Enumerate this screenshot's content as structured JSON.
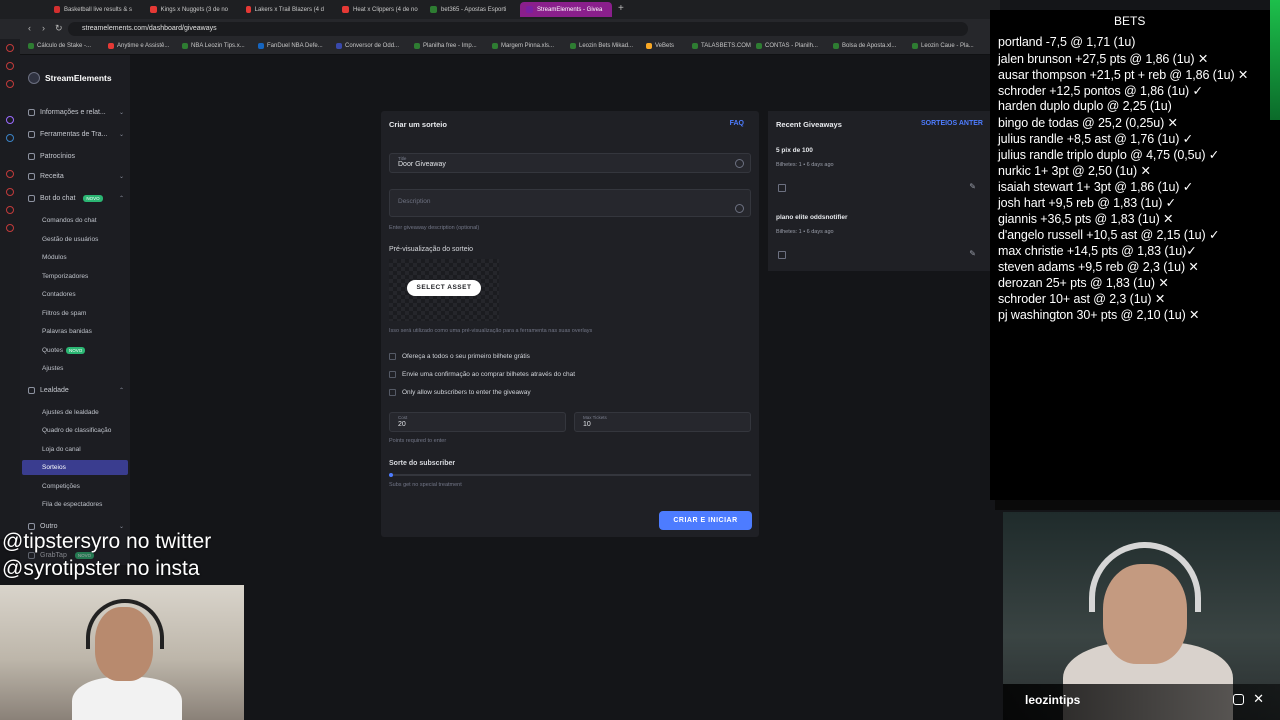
{
  "browser": {
    "tabs": [
      {
        "label": "Basketball live results & s",
        "color": "#d32f2f",
        "active": false
      },
      {
        "label": "Kings x Nuggets (3 de no",
        "color": "#e53935",
        "active": false
      },
      {
        "label": "Lakers x Trail Blazers (4 d",
        "color": "#e53935",
        "active": false
      },
      {
        "label": "Heat x Clippers (4 de no",
        "color": "#e53935",
        "active": false
      },
      {
        "label": "bet365 - Apostas Esporti",
        "color": "#2e7d32",
        "active": false
      },
      {
        "label": "StreamElements - Givea",
        "color": "#7b1fa2",
        "active": true
      }
    ],
    "url": "streamelements.com/dashboard/giveaways",
    "bookmarks": [
      "Cálculo de Stake -...",
      "Anytime e Assistê...",
      "NBA Leozin Tips.x...",
      "FanDuel NBA Defe...",
      "Conversor de Odd...",
      "Planilha free - Imp...",
      "Margem Pinna.xls...",
      "Leozin Bets Mikad...",
      "VeBets",
      "TALASBETS.COM",
      "CONTAS - Planilh...",
      "Bolsa de Aposta.xl...",
      "Leozin Caue - Pla..."
    ]
  },
  "sidebar": {
    "brand": "StreamElements",
    "items": [
      {
        "label": "Informações e relat...",
        "chevron": "⌄"
      },
      {
        "label": "Ferramentas de Tra...",
        "chevron": "⌄"
      },
      {
        "label": "Patrocínios",
        "chevron": ""
      },
      {
        "label": "Receita",
        "chevron": "⌄"
      },
      {
        "label": "Bot do chat",
        "chevron": "⌃",
        "badge": "NOVO"
      }
    ],
    "bot_sub": [
      "Comandos do chat",
      "Gestão de usuários",
      "Módulos",
      "Temporizadores",
      "Contadores",
      "Filtros de spam",
      "Palavras banidas",
      "Quotes",
      "Ajustes"
    ],
    "quotes_badge": "NOVO",
    "loyalty": {
      "label": "Lealdade",
      "chevron": "⌃"
    },
    "loyalty_sub": [
      "Ajustes de lealdade",
      "Quadro de classificação",
      "Loja do canal",
      "Sorteios",
      "Competições",
      "Fila de espectadores"
    ],
    "other": {
      "label": "Outro",
      "chevron": "⌄"
    },
    "grabtap": "GrabTap",
    "grabtap_badge": "NOVO"
  },
  "form": {
    "title": "Criar um sorteio",
    "faq": "FAQ",
    "title_label": "Title",
    "title_value": "Door Giveaway",
    "description_placeholder": "Description",
    "description_hint": "Enter giveaway description (optional)",
    "preview_label": "Pré-visualização do sorteio",
    "select_asset": "SELECT ASSET",
    "preview_hint": "Isso será utilizado como uma pré-visualização para a ferramenta nas suas overlays",
    "checkboxes": [
      "Ofereça a todos o seu primeiro bilhete grátis",
      "Envie uma confirmação ao comprar bilhetes através do chat",
      "Only allow subscribers to enter the giveaway"
    ],
    "cost_label": "Cost",
    "cost_value": "20",
    "max_label": "Max Tickets",
    "max_value": "10",
    "points_hint": "Points required to enter",
    "luck_label": "Sorte do subscriber",
    "luck_hint": "Subs get no special treatment",
    "luck_value": 0,
    "create_button": "CRIAR E INICIAR"
  },
  "recent": {
    "title": "Recent Giveaways",
    "link": "SORTEIOS ANTER",
    "items": [
      {
        "name": "5 pix de 100",
        "meta": "Bilhetes: 1  •  6 days ago"
      },
      {
        "name": "plano elite oddsnotifier",
        "meta": "Bilhetes: 1  •  6 days ago"
      }
    ]
  },
  "bets": {
    "title": "BETS",
    "lines": [
      "portland -7,5 @ 1,71 (1u)",
      "jalen brunson +27,5 pts @ 1,86 (1u) ✕",
      "ausar thompson +21,5 pt + reb @ 1,86 (1u) ✕",
      "schroder +12,5 pontos @ 1,86 (1u) ✓",
      "harden duplo duplo @ 2,25 (1u)",
      "bingo de todas @ 25,2 (0,25u) ✕",
      "julius randle +8,5 ast @ 1,76 (1u) ✓",
      "julius randle triplo duplo @ 4,75 (0,5u) ✓",
      "nurkic 1+ 3pt @ 2,50 (1u) ✕",
      "isaiah stewart 1+ 3pt @ 1,86 (1u) ✓",
      "josh hart +9,5 reb @ 1,83 (1u) ✓",
      "giannis +36,5 pts @ 1,83 (1u) ✕",
      "d'angelo russell +10,5 ast @ 2,15 (1u) ✓",
      "max christie +14,5 pts @ 1,83 (1u)✓",
      "steven adams +9,5 reb @ 2,3 (1u) ✕",
      "derozan 25+ pts @ 1,83 (1u) ✕",
      "schroder 10+ ast @ 2,3 (1u) ✕",
      "pj washington 30+ pts @ 2,10 (1u) ✕"
    ]
  },
  "social": {
    "twitter": "@tipstersyro no twitter",
    "insta": "@syrotipster no insta"
  },
  "webcam": {
    "name": "leozintips",
    "x_glyph": "✕"
  }
}
